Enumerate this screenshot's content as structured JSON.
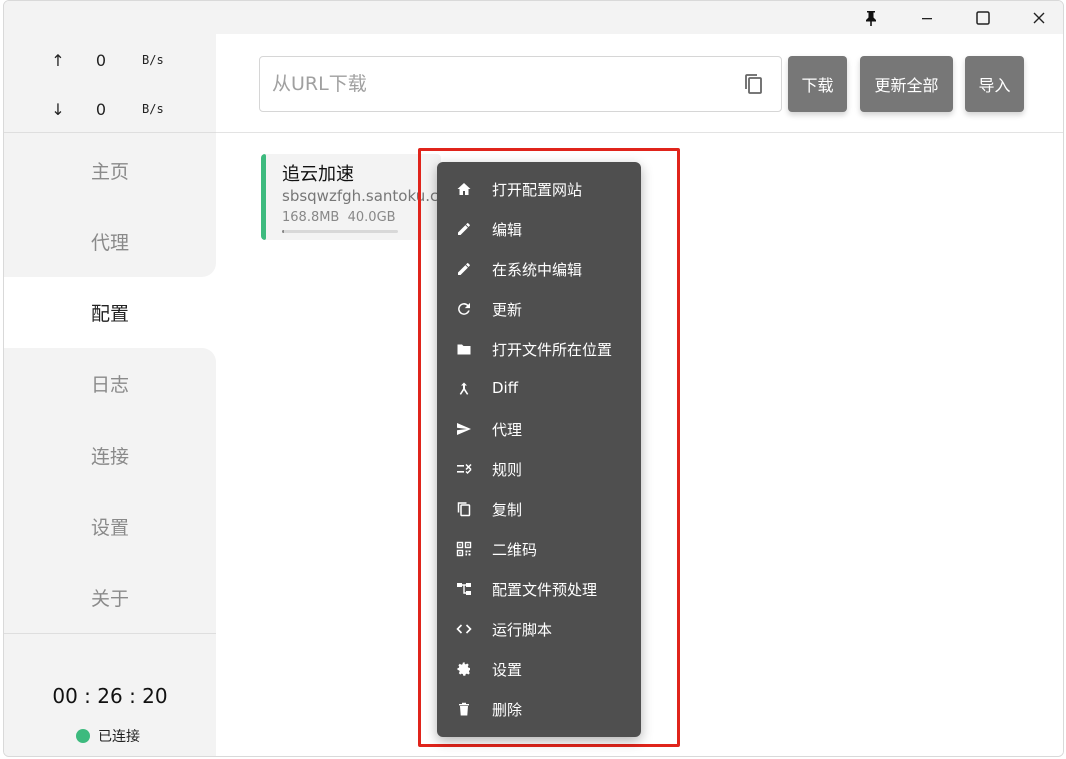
{
  "window": {
    "title_bar": {
      "pin_icon": "pin-icon",
      "minimize_icon": "minimize-icon",
      "maximize_icon": "maximize-icon",
      "close_icon": "close-icon"
    }
  },
  "sidebar": {
    "traffic": {
      "up_arrow": "↑",
      "up_value": "0",
      "up_unit": "B/s",
      "down_arrow": "↓",
      "down_value": "0",
      "down_unit": "B/s"
    },
    "nav": [
      {
        "label": "主页",
        "active": false
      },
      {
        "label": "代理",
        "active": false
      },
      {
        "label": "配置",
        "active": true
      },
      {
        "label": "日志",
        "active": false
      },
      {
        "label": "连接",
        "active": false
      },
      {
        "label": "设置",
        "active": false
      },
      {
        "label": "关于",
        "active": false
      }
    ],
    "timer": "00 : 26 : 20",
    "status": {
      "label": "已连接",
      "color": "#3dba7e"
    }
  },
  "toolbar": {
    "url_placeholder": "从URL下载",
    "url_value": "",
    "download_label": "下载",
    "update_all_label": "更新全部",
    "import_label": "导入"
  },
  "profile": {
    "name": "追云加速",
    "host": "sbsqwzfgh.santoku.c",
    "used": "168.8MB",
    "total": "40.0GB",
    "usage_fraction": 0.004,
    "accent_color": "#3dba7e"
  },
  "context_menu": {
    "items": [
      {
        "label": "打开配置网站",
        "icon": "home-icon"
      },
      {
        "label": "编辑",
        "icon": "pencil-icon"
      },
      {
        "label": "在系统中编辑",
        "icon": "pencil-icon"
      },
      {
        "label": "更新",
        "icon": "refresh-icon"
      },
      {
        "label": "打开文件所在位置",
        "icon": "folder-icon"
      },
      {
        "label": "Diff",
        "icon": "merge-icon"
      },
      {
        "label": "代理",
        "icon": "send-icon"
      },
      {
        "label": "规则",
        "icon": "rule-icon"
      },
      {
        "label": "复制",
        "icon": "copy-icon"
      },
      {
        "label": "二维码",
        "icon": "qrcode-icon"
      },
      {
        "label": "配置文件预处理",
        "icon": "tree-icon"
      },
      {
        "label": "运行脚本",
        "icon": "code-icon"
      },
      {
        "label": "设置",
        "icon": "gear-icon"
      },
      {
        "label": "删除",
        "icon": "trash-icon"
      }
    ],
    "highlight_color": "#e0241b"
  }
}
